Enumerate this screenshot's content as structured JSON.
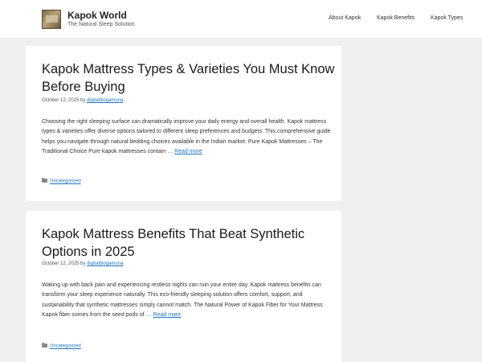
{
  "site": {
    "title": "Kapok World",
    "tagline": "The Natural Sleep Solution"
  },
  "nav": {
    "items": [
      {
        "label": "About Kapok"
      },
      {
        "label": "Kapok Benefits"
      },
      {
        "label": "Kapok Types"
      }
    ]
  },
  "posts": [
    {
      "title": "Kapok Mattress Types & Varieties You Must Know Before Buying",
      "date": "October 12, 2025",
      "by": "by",
      "author": "digitalblogamuna",
      "excerpt": "Choosing the right sleeping surface can dramatically improve your daily energy and overall health. Kapok mattress types & varieties offer diverse options tailored to different sleep preferences and budgets. This comprehensive guide helps you navigate through natural bedding choices available in the Indian market. Pure Kapok Mattresses – The Traditional Choice Pure kapok mattresses contain …",
      "read_more": "Read more",
      "category": "Uncategorized"
    },
    {
      "title": "Kapok Mattress Benefits That Beat Synthetic Options in 2025",
      "date": "October 12, 2025",
      "by": "by",
      "author": "digitalblogamuna",
      "excerpt": "Waking up with back pain and experiencing restless nights can ruin your entire day. Kapok mattress benefits can transform your sleep experience naturally. This eco-friendly sleeping solution offers comfort, support, and sustainability that synthetic mattresses simply cannot match. The Natural Power of Kapok Fiber for Your Mattress Kapok fiber comes from the seed pods of …",
      "read_more": "Read more",
      "category": "Uncategorized"
    }
  ]
}
